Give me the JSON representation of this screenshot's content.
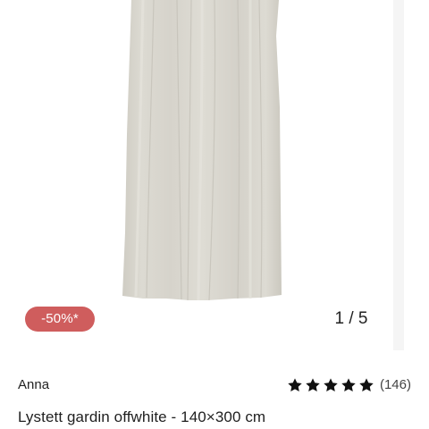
{
  "gallery": {
    "discount_badge": "-50%*",
    "counter": "1 / 5"
  },
  "product": {
    "brand": "Anna",
    "rating": 5,
    "review_count": "(146)",
    "title": "Lystett gardin offwhite - 140×300 cm"
  },
  "icons": [
    "star-icon"
  ],
  "colors": {
    "badge_background": "#cf5d5d",
    "curtain_fabric": "#d9d7cf",
    "star": "#111111"
  }
}
